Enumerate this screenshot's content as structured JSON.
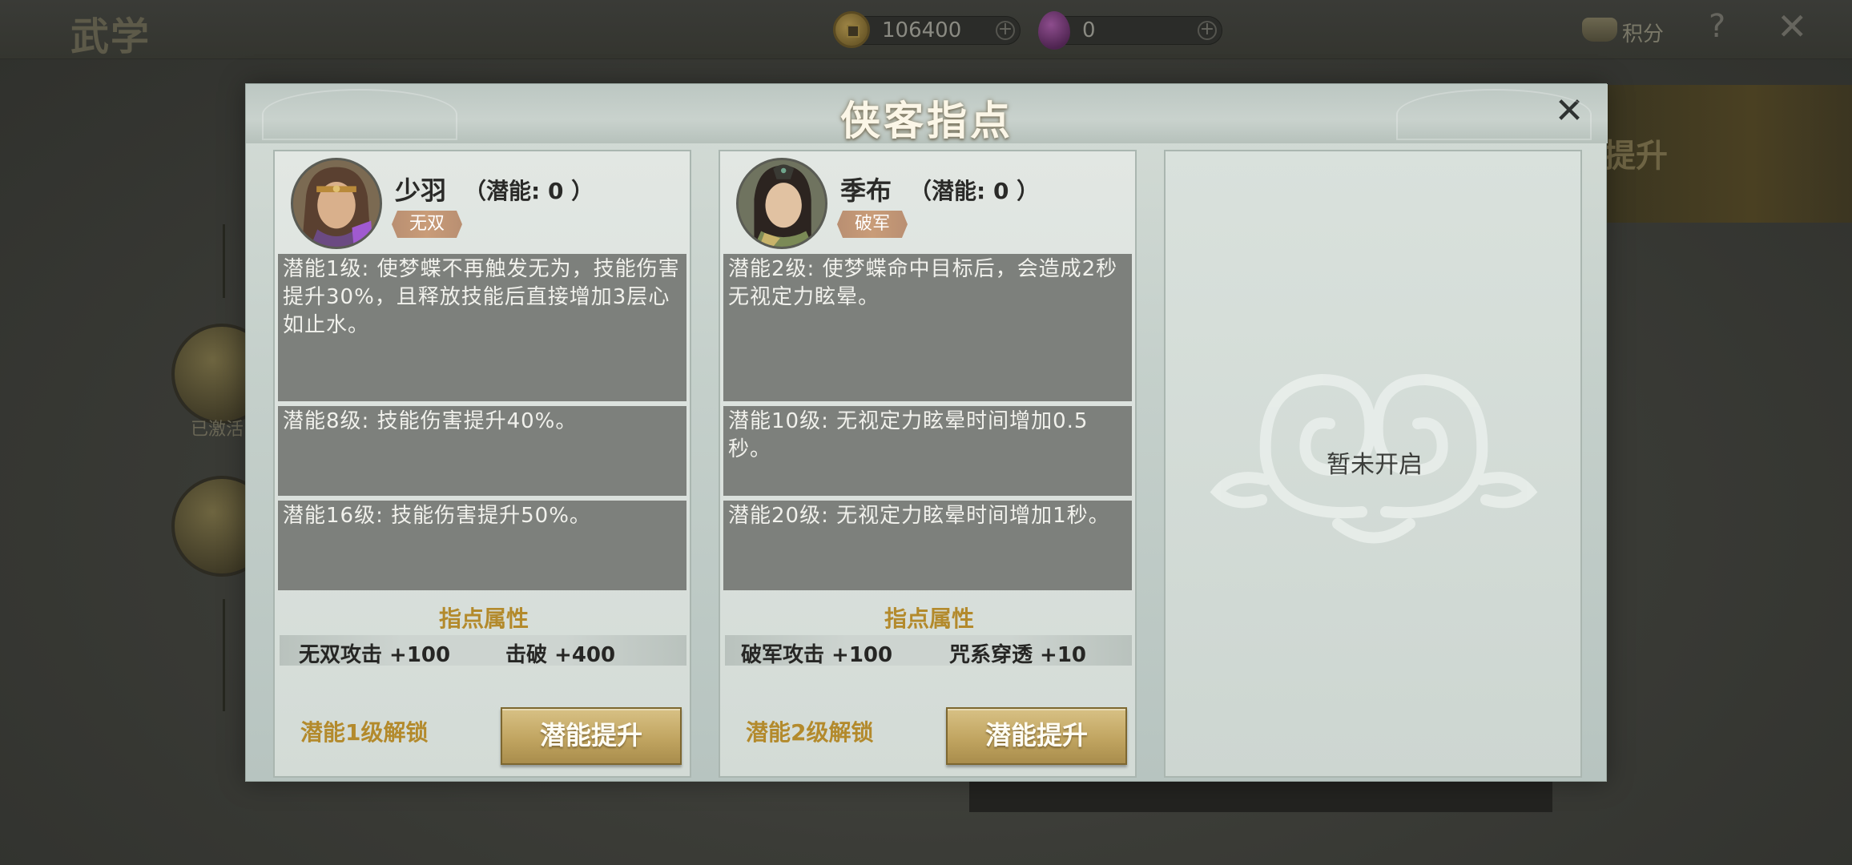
{
  "topbar": {
    "title": "武学",
    "coins": "106400",
    "gems": "0",
    "score_label": "积分",
    "help_symbol": "?",
    "close_symbol": "✕"
  },
  "background": {
    "activated_label": "已激活",
    "banner_text": "提升"
  },
  "modal": {
    "title": "侠客指点",
    "close_symbol": "✕",
    "cards": [
      {
        "name": "少羽",
        "potential": "（潜能: 0 ）",
        "tag": "无双",
        "descriptions": [
          "潜能1级: 使梦蝶不再触发无为，技能伤害提升30%，且释放技能后直接增加3层心如止水。",
          "潜能8级: 技能伤害提升40%。",
          "潜能16级: 技能伤害提升50%。"
        ],
        "attr_title": "指点属性",
        "attrs": [
          "无双攻击 +100",
          "击破 +400"
        ],
        "unlock": "潜能1级解锁",
        "button": "潜能提升"
      },
      {
        "name": "季布",
        "potential": "（潜能: 0 ）",
        "tag": "破军",
        "descriptions": [
          "潜能2级: 使梦蝶命中目标后，会造成2秒无视定力眩晕。",
          "潜能10级: 无视定力眩晕时间增加0.5秒。",
          "潜能20级: 无视定力眩晕时间增加1秒。"
        ],
        "attr_title": "指点属性",
        "attrs": [
          "破军攻击 +100",
          "咒系穿透 +10"
        ],
        "unlock": "潜能2级解锁",
        "button": "潜能提升"
      }
    ],
    "locked_text": "暂未开启"
  },
  "colors": {
    "gold_text": "#b38a2c",
    "button_gold": "#c1a561",
    "desc_bg": "#7d807c",
    "tag_bg": "#c99c78"
  }
}
